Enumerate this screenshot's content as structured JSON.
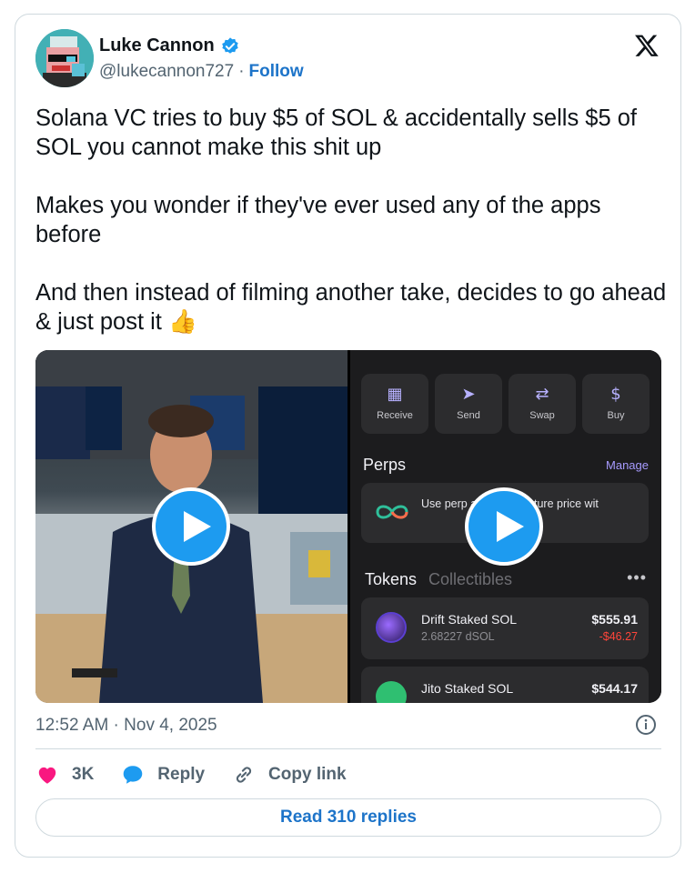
{
  "author": {
    "name": "Luke Cannon",
    "handle": "@lukecannon727",
    "separator": "·",
    "follow_label": "Follow"
  },
  "tweet": {
    "text": "Solana VC tries to buy $5 of SOL & accidentally sells $5 of SOL you cannot make this shit up\n\nMakes you wonder if they've ever used any of the apps before\n\nAnd then instead of filming another take, decides to go ahead & just post it 👍"
  },
  "media": {
    "right_panel": {
      "actions": [
        {
          "label": "Receive",
          "icon": "qr-icon"
        },
        {
          "label": "Send",
          "icon": "send-icon"
        },
        {
          "label": "Swap",
          "icon": "swap-icon"
        },
        {
          "label": "Buy",
          "icon": "dollar-icon"
        }
      ],
      "perps_title": "Perps",
      "manage_label": "Manage",
      "perps_text": "Use perp          an asset's future price wit",
      "tokens_title": "Tokens",
      "collectibles_title": "Collectibles",
      "more": "•••",
      "tokens": [
        {
          "name": "Drift Staked SOL",
          "amount": "2.68227 dSOL",
          "value": "$555.91",
          "change": "-$46.27"
        },
        {
          "name": "Jito Staked SOL",
          "amount": "",
          "value": "$544.17",
          "change": ""
        }
      ]
    }
  },
  "timestamp": "12:52 AM · Nov 4, 2025",
  "engagement": {
    "likes": "3K",
    "reply_label": "Reply",
    "copy_link_label": "Copy link"
  },
  "read_replies_label": "Read 310 replies",
  "colors": {
    "accent": "#1d9bf0",
    "link": "#1d74c9",
    "like": "#f91880",
    "muted": "#536471"
  }
}
